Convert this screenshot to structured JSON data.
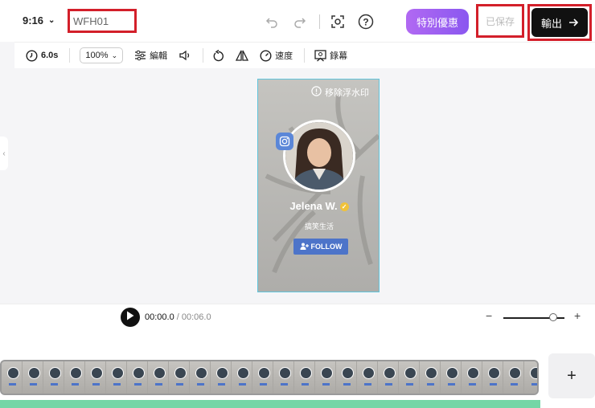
{
  "header": {
    "aspect_ratio": "9:16",
    "project_name": "WFH01",
    "promo_label": "特別優惠",
    "saved_label": "已保存",
    "export_label": "輸出"
  },
  "toolbar": {
    "duration": "6.0s",
    "zoom": "100%",
    "edit_label": "編輯",
    "speed_label": "速度",
    "record_label": "錄幕"
  },
  "canvas": {
    "watermark_label": "移除浮水印",
    "profile_name": "Jelena W.",
    "profile_subtitle": "搞笑生活",
    "follow_label": "FOLLOW"
  },
  "playback": {
    "current_time": "00:00.0",
    "total_time": " / 00:06.0"
  },
  "timeline": {
    "add_label": "+"
  },
  "colors": {
    "accent_purple": "#9b5ff0",
    "highlight_red": "#d31f2a",
    "selection_cyan": "#61c5dc",
    "follow_blue": "#4d74c9",
    "audio_green": "#74d6a6"
  }
}
